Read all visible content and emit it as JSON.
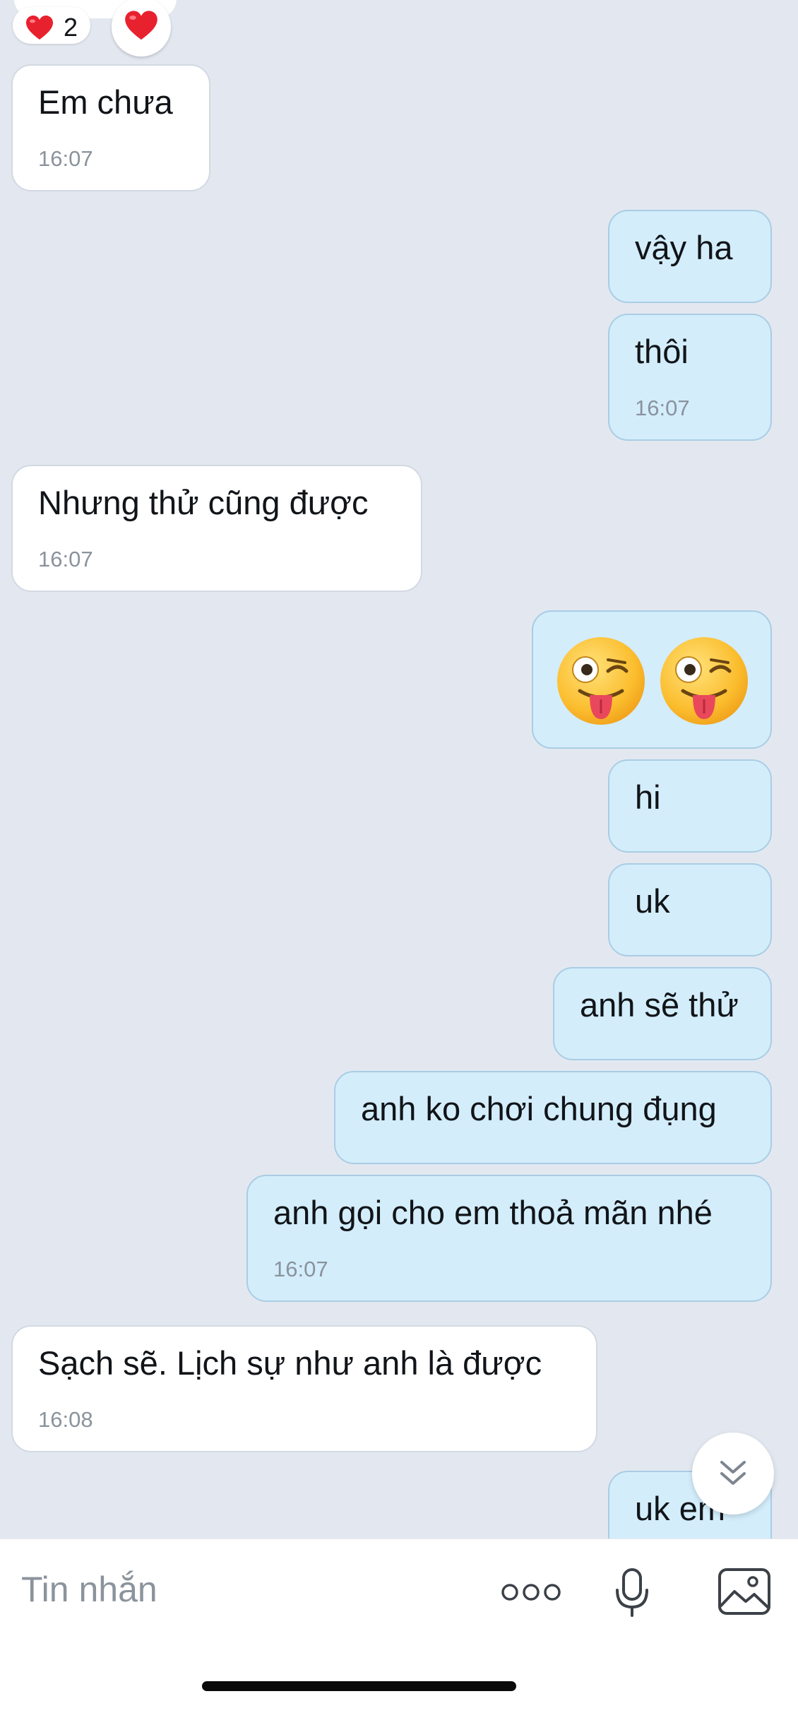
{
  "reactions": {
    "heart_count": "2"
  },
  "messages": [
    {
      "side": "in",
      "text": "Em chưa",
      "time": "16:07"
    },
    {
      "side": "out",
      "text": "vậy ha",
      "time": ""
    },
    {
      "side": "out",
      "text": "thôi",
      "time": "16:07"
    },
    {
      "side": "in",
      "text": "Nhưng thử cũng được",
      "time": "16:07"
    },
    {
      "side": "out",
      "text": "",
      "emoji": [
        "winking-face-with-tongue",
        "winking-face-with-tongue"
      ]
    },
    {
      "side": "out",
      "text": "hi",
      "time": ""
    },
    {
      "side": "out",
      "text": "uk",
      "time": ""
    },
    {
      "side": "out",
      "text": "anh sẽ thử",
      "time": ""
    },
    {
      "side": "out",
      "text": "anh ko chơi chung đụng",
      "time": ""
    },
    {
      "side": "out",
      "text": "anh gọi cho em thoả mãn nhé",
      "time": "16:07"
    },
    {
      "side": "in",
      "text": "Sạch sẽ. Lịch sự như anh là được",
      "time": "16:08"
    },
    {
      "side": "out",
      "text": "uk em",
      "time": ""
    }
  ],
  "composer": {
    "placeholder": "Tin nhắn",
    "icons": [
      "more-icon",
      "microphone-icon",
      "image-icon"
    ]
  },
  "colors": {
    "background": "#e3e8f0",
    "incoming_bubble": "#ffffff",
    "outgoing_bubble": "#d3edfb",
    "outgoing_border": "#a9cde5",
    "heart": "#e8212f"
  }
}
